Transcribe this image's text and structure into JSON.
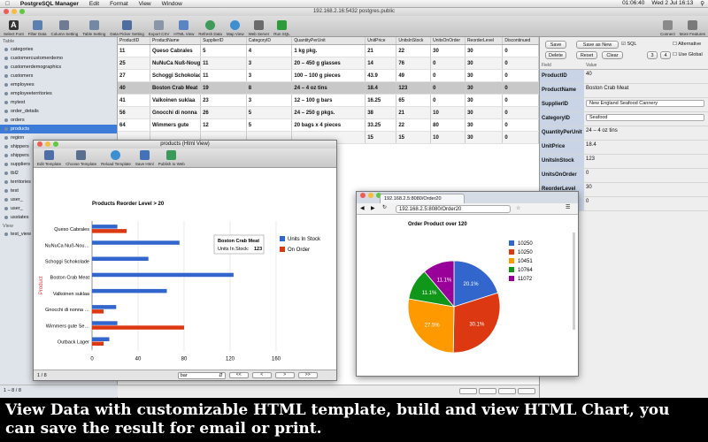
{
  "menubar": {
    "app": "PostgreSQL Manager",
    "items": [
      "Edit",
      "Format",
      "View",
      "Window"
    ],
    "clock": "Wed 2 Jul 16:13",
    "battery": "01:06:40"
  },
  "window": {
    "title": "192.168.2.16:5432 postgres.public"
  },
  "toolbar": {
    "items": [
      "Select Font",
      "Filter Data",
      "Column Setting",
      "Table Setting",
      "Data Picker Setting",
      "Export CSV",
      "HTML View",
      "Refresh Data",
      "Map View",
      "Web Server",
      "Run SQL"
    ],
    "right": [
      "Connect",
      "More Features"
    ]
  },
  "sidebar": {
    "table_section": "Table",
    "tables": [
      "categories",
      "customercustomerdemo",
      "customerdemographics",
      "customers",
      "employees",
      "employeeterritories",
      "mytest",
      "order_details",
      "orders",
      "products",
      "region",
      "shippers",
      "shippers",
      "suppliers",
      "tbl2",
      "territories",
      "test",
      "user_",
      "user_",
      "usstates"
    ],
    "selected_index": 9,
    "view_section": "View",
    "views": [
      "test_view"
    ],
    "status": "1 – 8 / 8"
  },
  "grid": {
    "columns": [
      "ProductID",
      "ProductName",
      "SupplierID",
      "CategoryID",
      "QuantityPerUnit",
      "UnitPrice",
      "UnitsInStock",
      "UnitsOnOrder",
      "ReorderLevel",
      "Discontinued"
    ],
    "rows": [
      [
        "11",
        "Queso Cabrales",
        "5",
        "4",
        "1 kg pkg.",
        "21",
        "22",
        "30",
        "30",
        "0"
      ],
      [
        "25",
        "NuNuCa Nuß-Nougat",
        "11",
        "3",
        "20 – 450 g glasses",
        "14",
        "76",
        "0",
        "30",
        "0"
      ],
      [
        "27",
        "Schoggi Schokolade",
        "11",
        "3",
        "100 – 100 g pieces",
        "43.9",
        "49",
        "0",
        "30",
        "0"
      ],
      [
        "40",
        "Boston Crab Meat",
        "19",
        "8",
        "24 – 4 oz tins",
        "18.4",
        "123",
        "0",
        "30",
        "0"
      ],
      [
        "41",
        "Valkoinen suklaa",
        "23",
        "3",
        "12 – 100 g bars",
        "16.25",
        "65",
        "0",
        "30",
        "0"
      ],
      [
        "56",
        "Gnocchi di nonna",
        "26",
        "5",
        "24 – 250 g pkgs.",
        "38",
        "21",
        "10",
        "30",
        "0"
      ],
      [
        "64",
        "Wimmers gute",
        "12",
        "5",
        "20 bags x 4 pieces",
        "33.25",
        "22",
        "80",
        "30",
        "0"
      ],
      [
        "",
        "",
        "",
        "",
        "",
        "15",
        "15",
        "10",
        "30",
        "0"
      ]
    ],
    "selected_row": 3
  },
  "detail": {
    "buttons": {
      "save": "Save",
      "save_as_new": "Save as New",
      "sql": "SQL",
      "alternative": "Alternative",
      "delete": "Delete",
      "reset": "Reset",
      "clear": "Clear",
      "num3": "3",
      "num4": "4",
      "use_global": "Use Global"
    },
    "field_header": "Field",
    "value_header": "Value",
    "fields": [
      {
        "k": "ProductID",
        "v": "40"
      },
      {
        "k": "ProductName",
        "v": "Boston Crab Meat"
      },
      {
        "k": "SupplierID",
        "v": "New England Seafood Cannery"
      },
      {
        "k": "CategoryID",
        "v": "Seafood"
      },
      {
        "k": "QuantityPerUnit",
        "v": "24 – 4 oz tins"
      },
      {
        "k": "UnitPrice",
        "v": "18.4"
      },
      {
        "k": "UnitsInStock",
        "v": "123"
      },
      {
        "k": "UnitsOnOrder",
        "v": "0"
      },
      {
        "k": "ReorderLevel",
        "v": "30"
      },
      {
        "k": "Discontinued",
        "v": "0"
      }
    ]
  },
  "html_view": {
    "title": "products (Html View)",
    "tools": [
      "Edit Template",
      "Choose Template",
      "Reload Template",
      "Save Html",
      "Publish to Web"
    ],
    "page": "1 / 8",
    "chart_type_select": "bar",
    "nav": [
      "<<",
      "<",
      ">",
      ">>"
    ]
  },
  "browser": {
    "tab_title": "192.168.2.5:8080/Order20",
    "url": "192.168.2.5:8080/Order20"
  },
  "caption": "View Data with customizable HTML template, build and view HTML Chart, you can save the result for email or print.",
  "chart_data": [
    {
      "type": "bar",
      "orientation": "horizontal",
      "title": "Products Reorder Level > 20",
      "ylabel": "Product",
      "categories": [
        "Queso Cabrales",
        "NuNuCa Nuß-Nou…",
        "Schoggi Schokolade",
        "Boston Crab Meat",
        "Valkoinen suklaa",
        "Gnocchi di nonna …",
        "Wimmers gute Se…",
        "Outback Lager"
      ],
      "series": [
        {
          "name": "Units In Stock",
          "color": "#3366cc",
          "values": [
            22,
            76,
            49,
            123,
            65,
            21,
            22,
            15
          ]
        },
        {
          "name": "On Order",
          "color": "#dc3912",
          "values": [
            30,
            0,
            0,
            0,
            0,
            10,
            80,
            10
          ]
        }
      ],
      "xlim": [
        0,
        160
      ],
      "ticks": [
        0,
        40,
        80,
        120,
        160
      ],
      "tooltip": {
        "title": "Boston Crab Meat",
        "label": "Units In Stock:",
        "value": "123"
      },
      "legend": "right"
    },
    {
      "type": "pie",
      "title": "Order Product over 120",
      "labels": [
        "10250",
        "10250",
        "10451",
        "10764",
        "11072"
      ],
      "values": [
        20.1,
        30.1,
        27.5,
        11.1,
        11.1
      ],
      "display": [
        "20.1%",
        "30.1%",
        "27.5%",
        "11.1%",
        "11.1%"
      ],
      "colors": [
        "#3366cc",
        "#dc3912",
        "#ff9900",
        "#109618",
        "#990099"
      ],
      "legend": "right"
    }
  ]
}
